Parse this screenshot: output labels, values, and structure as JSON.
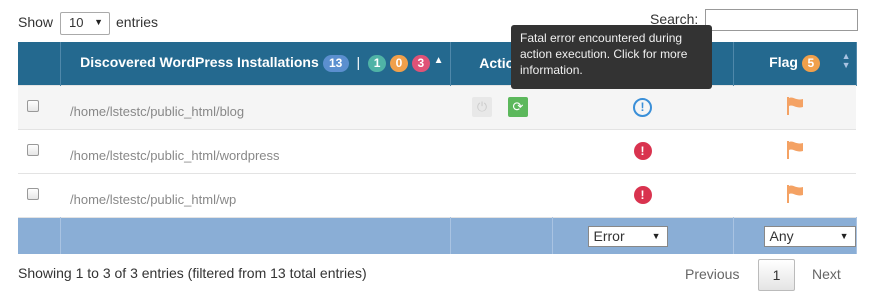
{
  "length_menu": {
    "show_label": "Show",
    "selected": "10",
    "entries_label": "entries"
  },
  "search": {
    "label": "Search:",
    "value": ""
  },
  "columns": {
    "path": {
      "label": "Discovered WordPress Installations",
      "count_total": "13",
      "separator": "|",
      "count_teal": "1",
      "count_orange": "0",
      "count_pink": "3"
    },
    "action": {
      "label": "Action"
    },
    "flag": {
      "label": "Flag",
      "count": "5"
    }
  },
  "tooltip": {
    "text": "Fatal error encountered during action execution. Click for more information."
  },
  "rows": [
    {
      "path": "/home/lstestc/public_html/blog",
      "status_icon": "info-circle-icon",
      "has_actions": true
    },
    {
      "path": "/home/lstestc/public_html/wordpress",
      "status_icon": "error-circle-icon",
      "has_actions": false
    },
    {
      "path": "/home/lstestc/public_html/wp",
      "status_icon": "error-circle-icon",
      "has_actions": false
    }
  ],
  "filters": {
    "status_selected": "Error",
    "flag_selected": "Any"
  },
  "footer": {
    "info": "Showing 1 to 3 of 3 entries (filtered from 13 total entries)",
    "previous": "Previous",
    "page": "1",
    "next": "Next"
  },
  "colors": {
    "header_bg": "#24698f",
    "footer_bg": "#8aaed6",
    "badge_blue": "#5b8fcf",
    "badge_teal": "#4fb3a6",
    "badge_orange": "#f0a04b",
    "badge_pink": "#e05277",
    "flag_orange": "#f4a264",
    "error_red": "#d9334f",
    "info_blue": "#3a8fd8"
  }
}
